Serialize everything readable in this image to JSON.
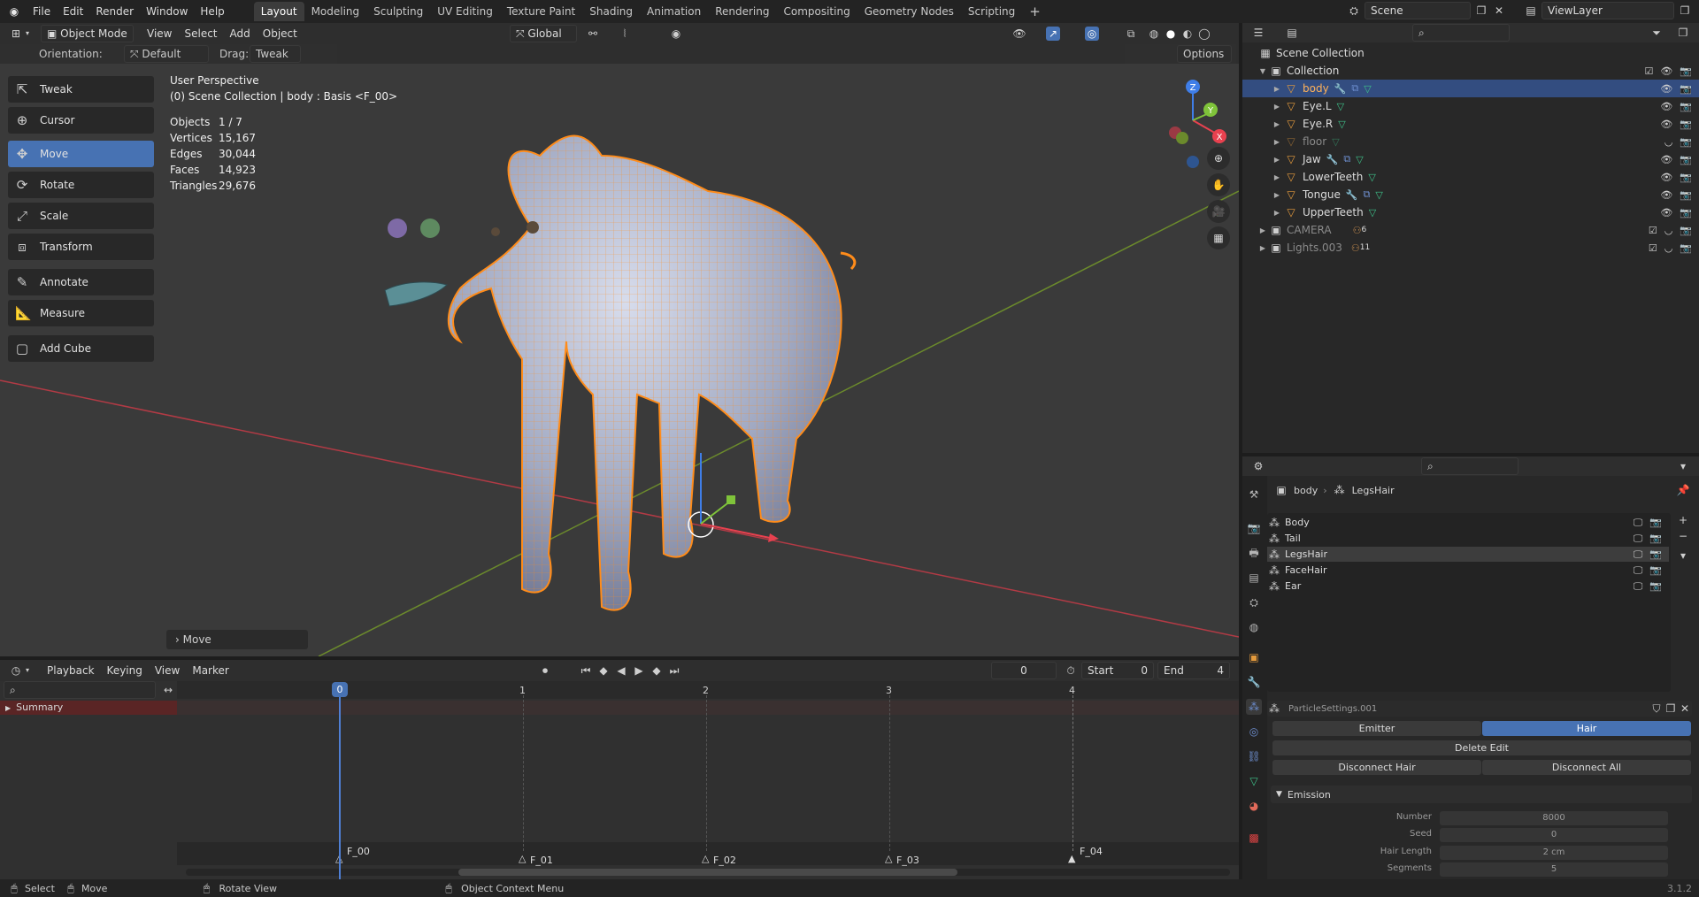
{
  "topbar": {
    "menus": [
      "File",
      "Edit",
      "Render",
      "Window",
      "Help"
    ],
    "workspaces": [
      "Layout",
      "Modeling",
      "Sculpting",
      "UV Editing",
      "Texture Paint",
      "Shading",
      "Animation",
      "Rendering",
      "Compositing",
      "Geometry Nodes",
      "Scripting"
    ],
    "add_tab": "+",
    "scene": "Scene",
    "view_layer": "ViewLayer"
  },
  "viewport": {
    "mode": "Object Mode",
    "menus": [
      "View",
      "Select",
      "Add",
      "Object"
    ],
    "transform_orientation": "Global",
    "orientation_label": "Orientation:",
    "orientation_value": "Default",
    "drag_label": "Drag:",
    "drag_value": "Tweak",
    "options_label": "Options",
    "tools": [
      "Tweak",
      "Cursor",
      "Move",
      "Rotate",
      "Scale",
      "Transform",
      "Annotate",
      "Measure",
      "Add Cube"
    ],
    "active_tool": "Move",
    "perspective": "User Perspective",
    "context": "(0) Scene Collection | body : Basis <F_00>",
    "stats": [
      {
        "label": "Objects",
        "value": "1 / 7"
      },
      {
        "label": "Vertices",
        "value": "15,167"
      },
      {
        "label": "Edges",
        "value": "30,044"
      },
      {
        "label": "Faces",
        "value": "14,923"
      },
      {
        "label": "Triangles",
        "value": "29,676"
      }
    ],
    "gizmo": {
      "x": "X",
      "y": "Y",
      "z": "Z"
    },
    "last_op": "Move"
  },
  "outliner": {
    "root": "Scene Collection",
    "collection": "Collection",
    "items": [
      {
        "name": "body",
        "selected": true,
        "dim": false
      },
      {
        "name": "Eye.L",
        "selected": false,
        "dim": false
      },
      {
        "name": "Eye.R",
        "selected": false,
        "dim": false
      },
      {
        "name": "floor",
        "selected": false,
        "dim": true
      },
      {
        "name": "Jaw",
        "selected": false,
        "dim": false
      },
      {
        "name": "LowerTeeth",
        "selected": false,
        "dim": false
      },
      {
        "name": "Tongue",
        "selected": false,
        "dim": false
      },
      {
        "name": "UpperTeeth",
        "selected": false,
        "dim": false
      }
    ],
    "camera": {
      "name": "CAMERA",
      "count": "6"
    },
    "lights": {
      "name": "Lights.003",
      "count": "11"
    }
  },
  "properties": {
    "breadcrumb_object": "body",
    "breadcrumb_system": "LegsHair",
    "systems": [
      "Body",
      "Tail",
      "LegsHair",
      "FaceHair",
      "Ear"
    ],
    "active_system": "LegsHair",
    "settings_name": "ParticleSettings.001",
    "type_emitter": "Emitter",
    "type_hair": "Hair",
    "delete_edit": "Delete Edit",
    "disconnect_hair": "Disconnect Hair",
    "disconnect_all": "Disconnect All",
    "emission_title": "Emission",
    "fields": [
      {
        "label": "Number",
        "value": "8000"
      },
      {
        "label": "Seed",
        "value": "0"
      },
      {
        "label": "Hair Length",
        "value": "2 cm"
      },
      {
        "label": "Segments",
        "value": "5"
      }
    ]
  },
  "timeline": {
    "menus": [
      "Playback",
      "Keying",
      "View",
      "Marker"
    ],
    "current_frame": "0",
    "start_label": "Start",
    "start": "0",
    "end_label": "End",
    "end": "4",
    "summary": "Summary",
    "ticks": [
      "0",
      "1",
      "2",
      "3",
      "4"
    ],
    "markers": [
      "F_00",
      "F_01",
      "F_02",
      "F_03",
      "F_04"
    ]
  },
  "status": {
    "select": "Select",
    "move": "Move",
    "rotate": "Rotate View",
    "context_menu": "Object Context Menu",
    "version": "3.1.2"
  },
  "colors": {
    "accent": "#4772b3",
    "selection_outline": "#ff8c1a",
    "outliner_selected": "#334d80",
    "summary_red": "#5a2525"
  }
}
